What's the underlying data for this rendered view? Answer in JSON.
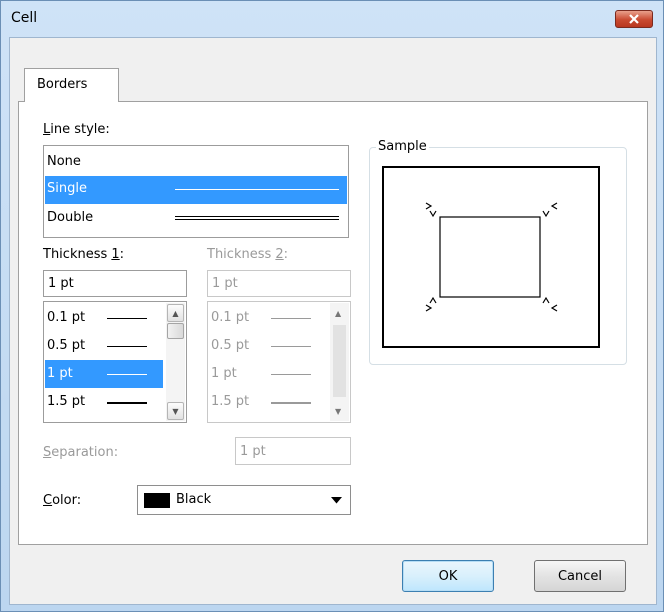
{
  "window": {
    "title": "Cell"
  },
  "tabs": [
    {
      "label": "Borders"
    }
  ],
  "line_style": {
    "label_pre": "",
    "label_key": "L",
    "label_post": "ine style:",
    "options": [
      "None",
      "Single",
      "Double"
    ],
    "selected": "Single"
  },
  "thickness1": {
    "label_pre": "Thickness ",
    "label_key": "1",
    "label_post": ":",
    "value": "1 pt",
    "options": [
      "0.1 pt",
      "0.5 pt",
      "1 pt",
      "1.5 pt"
    ],
    "selected": "1 pt"
  },
  "thickness2": {
    "label_pre": "Thickness ",
    "label_key": "2",
    "label_post": ":",
    "value": "1 pt",
    "options": [
      "0.1 pt",
      "0.5 pt",
      "1 pt",
      "1.5 pt"
    ]
  },
  "separation": {
    "label_pre": "",
    "label_key": "S",
    "label_post": "eparation:",
    "value": "1 pt"
  },
  "color": {
    "label_pre": "",
    "label_key": "C",
    "label_post": "olor:",
    "value": "Black",
    "swatch": "#000000"
  },
  "sample": {
    "label": "Sample"
  },
  "buttons": {
    "ok": "OK",
    "cancel": "Cancel"
  },
  "colors": {
    "selection": "#3399ff",
    "close": "#c94a31",
    "frame": "#bcd6f0"
  }
}
